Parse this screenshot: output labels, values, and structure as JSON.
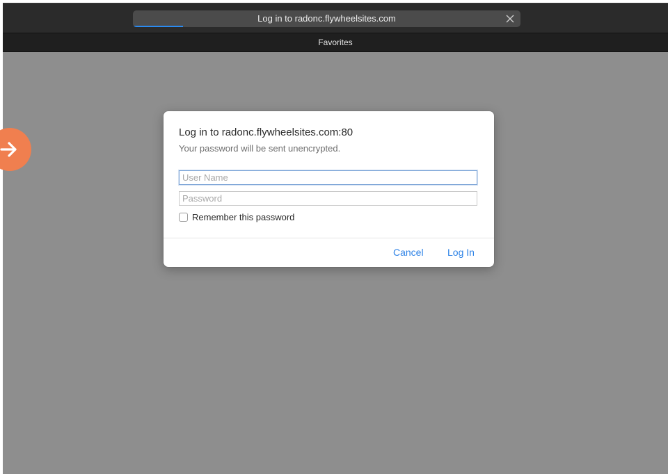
{
  "browser": {
    "address_title": "Log in to radonc.flywheelsites.com",
    "load_progress": 0.13,
    "favorites_label": "Favorites",
    "close_icon": "close-icon",
    "side_button_icon": "arrow-right-icon"
  },
  "dialog": {
    "title": "Log in to radonc.flywheelsites.com:80",
    "subtitle": "Your password will be sent unencrypted.",
    "username": {
      "value": "",
      "placeholder": "User Name"
    },
    "password": {
      "value": "",
      "placeholder": "Password"
    },
    "remember_label": "Remember this password",
    "remember_checked": false,
    "cancel_label": "Cancel",
    "login_label": "Log In"
  },
  "colors": {
    "accent": "#2d82e6",
    "side_button": "#f07f4f",
    "progress": "#2a8bf2",
    "backdrop": "#8e8e8e"
  }
}
